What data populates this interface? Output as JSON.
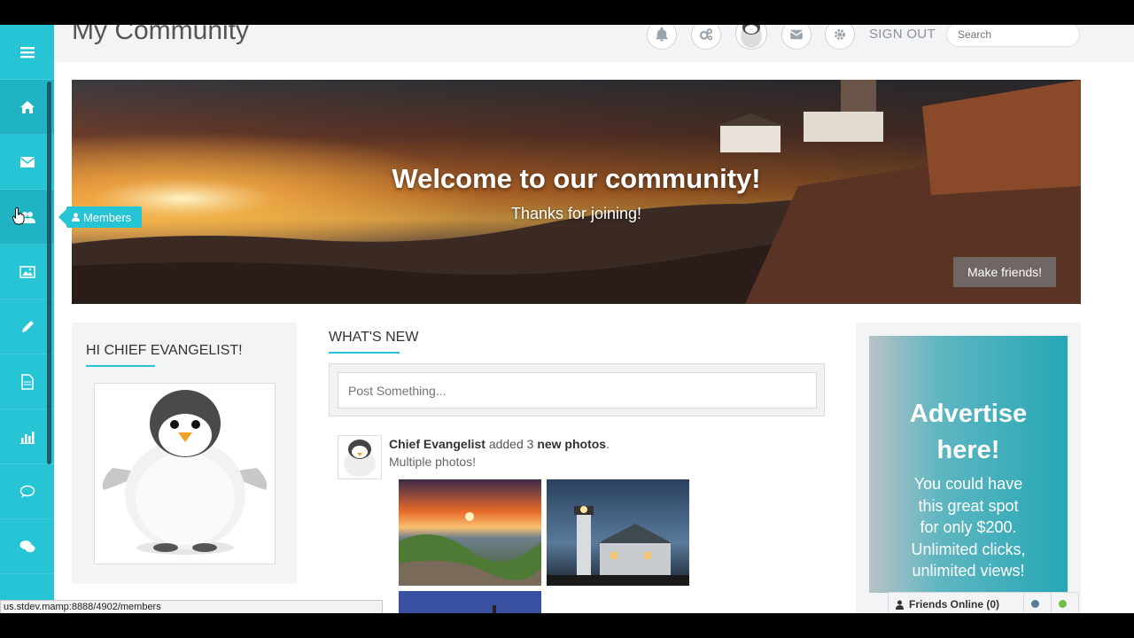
{
  "header": {
    "site_title": "My Community",
    "signout_label": "SIGN OUT",
    "search_placeholder": "Search"
  },
  "sidebar": {
    "items": [
      {
        "icon": "menu-icon"
      },
      {
        "icon": "home-icon"
      },
      {
        "icon": "mail-icon"
      },
      {
        "icon": "members-icon"
      },
      {
        "icon": "photos-icon"
      },
      {
        "icon": "pencil-icon"
      },
      {
        "icon": "document-icon"
      },
      {
        "icon": "bar-chart-icon"
      },
      {
        "icon": "chat-bubble-icon"
      },
      {
        "icon": "chat-bubbles-icon"
      }
    ],
    "tooltip": "Members"
  },
  "hero": {
    "title": "Welcome to our community!",
    "subtitle": "Thanks for joining!",
    "button": "Make friends!"
  },
  "left_card": {
    "heading": "HI CHIEF EVANGELIST!"
  },
  "feed": {
    "heading": "WHAT'S NEW",
    "post_placeholder": "Post Something...",
    "item": {
      "author": "Chief Evangelist",
      "action": "added 3",
      "object": "new photos",
      "period": ".",
      "caption": "Multiple photos!"
    }
  },
  "ad": {
    "title_line1": "Advertise",
    "title_line2": "here!",
    "body_lines": [
      "You could have",
      "this great spot",
      "for only $200.",
      "Unlimited clicks,",
      "unlimited views!"
    ]
  },
  "friends_online": {
    "label": "Friends Online (0)"
  },
  "status_bar": {
    "url": "us.stdev.mamp:8888/4902/members"
  },
  "colors": {
    "accent": "#27c4d6",
    "online_dot": "#6cc04a",
    "offline_dot": "#5d7d92"
  }
}
